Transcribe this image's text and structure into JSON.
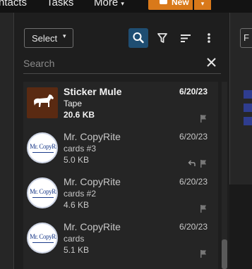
{
  "topnav": {
    "contacts": "ntacts",
    "tasks": "Tasks",
    "more": "More",
    "more_caret": "▾",
    "new_label": "New",
    "new_caret": "▾"
  },
  "toolbar": {
    "select_label": "Select",
    "select_caret": "▾"
  },
  "search": {
    "placeholder": "Search"
  },
  "messages": [
    {
      "sender": "Sticker Mule",
      "subject": "Tape",
      "size": "20.6 KB",
      "date": "6/20/23"
    },
    {
      "sender": "Mr. CopyRite",
      "subject": "cards #3",
      "size": "5.0 KB",
      "date": "6/20/23"
    },
    {
      "sender": "Mr. CopyRite",
      "subject": "cards #2",
      "size": "4.6 KB",
      "date": "6/20/23"
    },
    {
      "sender": "Mr. CopyRite",
      "subject": "cards",
      "size": "5.1 KB",
      "date": "6/20/23"
    }
  ],
  "logo_text": "Mr. CopyRite",
  "right_panel": {
    "box_letter": "F"
  },
  "colors": {
    "accent": "#d9791a",
    "active_tool": "#1f4e72",
    "link_blue": "#2f3d8f"
  },
  "icons": [
    "search-icon",
    "filter-icon",
    "sort-icon",
    "more-vertical-icon",
    "close-icon",
    "flag-icon",
    "reply-icon",
    "horse-icon"
  ]
}
